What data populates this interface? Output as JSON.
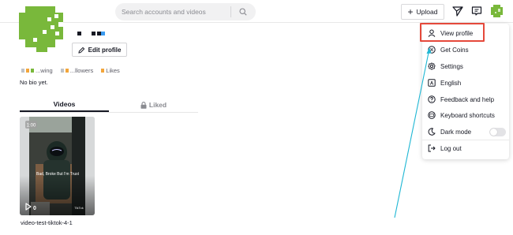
{
  "header": {
    "search_placeholder": "Search accounts and videos",
    "upload_label": "Upload",
    "icons": [
      "search-icon",
      "send-icon",
      "inbox-icon"
    ]
  },
  "profile": {
    "edit_label": "Edit profile",
    "stats": [
      {
        "value": "",
        "label": "...wing"
      },
      {
        "value": "",
        "label": "...llowers"
      },
      {
        "value": "",
        "label": "Likes"
      }
    ],
    "bio": "No bio yet."
  },
  "tabs": {
    "videos": "Videos",
    "liked": "Liked"
  },
  "video": {
    "duration": "1:00",
    "views": "0",
    "overlay_text": "Bad, Broke But I'm Trust",
    "watermark": "TikTok",
    "caption": "video-test-tiktok-4-1"
  },
  "menu": {
    "items": [
      {
        "label": "View profile",
        "icon": "person-icon"
      },
      {
        "label": "Get Coins",
        "icon": "coin-icon"
      },
      {
        "label": "Settings",
        "icon": "gear-icon"
      },
      {
        "label": "English",
        "icon": "language-icon"
      },
      {
        "label": "Feedback and help",
        "icon": "help-icon"
      },
      {
        "label": "Keyboard shortcuts",
        "icon": "keyboard-icon"
      },
      {
        "label": "Dark mode",
        "icon": "moon-icon"
      },
      {
        "label": "Log out",
        "icon": "logout-icon"
      }
    ],
    "dark_mode_on": false
  },
  "colors": {
    "avatar_green": "#79b83b",
    "highlight_red": "#e5493b",
    "arrow_teal": "#1fb7d4",
    "mark_blue": "#3a9bf0",
    "mark_orange": "#f3a63b"
  }
}
